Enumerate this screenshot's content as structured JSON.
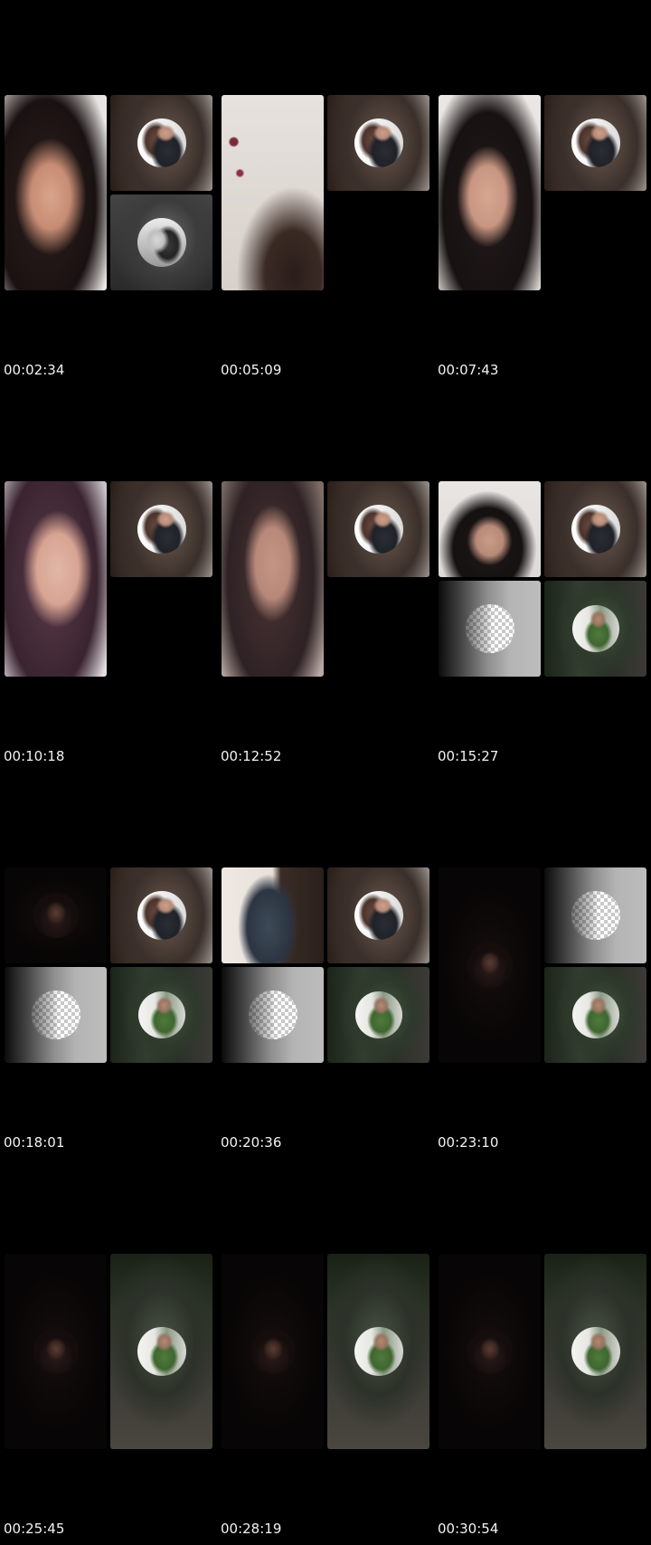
{
  "frames": [
    {
      "timestamp": "00:02:34"
    },
    {
      "timestamp": "00:05:09"
    },
    {
      "timestamp": "00:07:43"
    },
    {
      "timestamp": "00:10:18"
    },
    {
      "timestamp": "00:12:52"
    },
    {
      "timestamp": "00:15:27"
    },
    {
      "timestamp": "00:18:01"
    },
    {
      "timestamp": "00:20:36"
    },
    {
      "timestamp": "00:23:10"
    },
    {
      "timestamp": "00:25:45"
    },
    {
      "timestamp": "00:28:19"
    },
    {
      "timestamp": "00:30:54"
    }
  ]
}
